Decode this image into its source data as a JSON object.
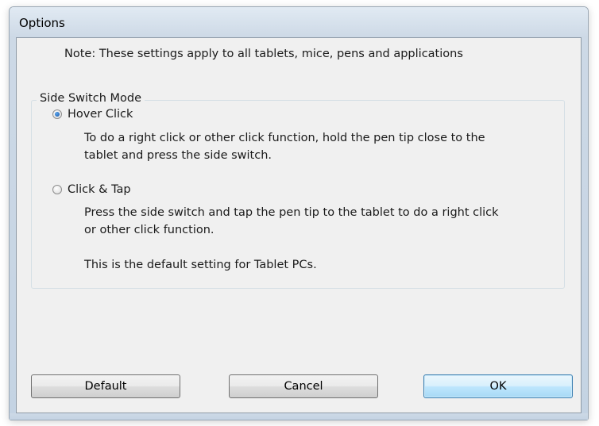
{
  "window": {
    "title": "Options"
  },
  "note": "Note: These settings apply to all tablets, mice, pens and applications",
  "side_switch_mode": {
    "group_title": "Side Switch Mode",
    "options": [
      {
        "label": "Hover Click",
        "selected": true,
        "description_lines": [
          "To do a right click or other click function, hold the pen tip close to the",
          "tablet and press the side switch."
        ]
      },
      {
        "label": "Click & Tap",
        "selected": false,
        "description_lines": [
          "Press the side switch and tap the pen tip to the tablet to do a right click",
          "or other click function.",
          "This is the default setting for Tablet PCs."
        ]
      }
    ]
  },
  "buttons": {
    "default": "Default",
    "cancel": "Cancel",
    "ok": "OK"
  },
  "colors": {
    "title_bar": "#cdd9e6",
    "client_bg": "#f0f0f0",
    "primary_button_border": "#3c7fb1",
    "radio_selected": "#1a56a6"
  }
}
